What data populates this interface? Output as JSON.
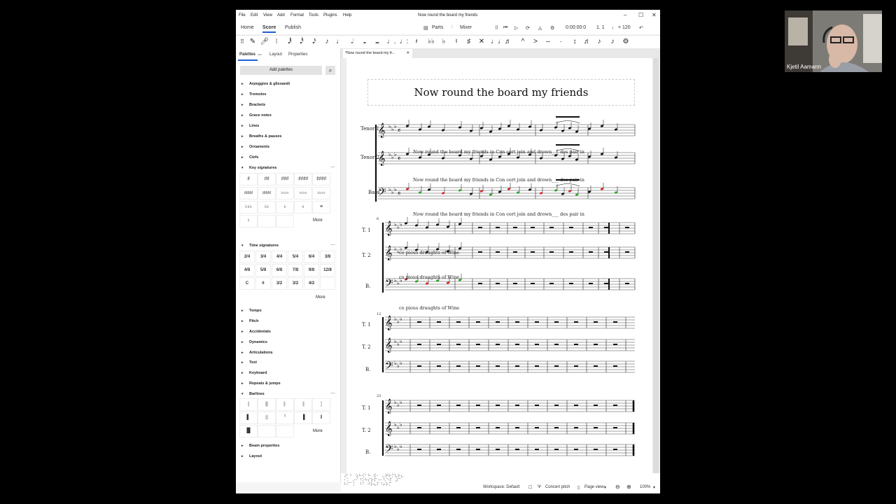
{
  "app": {
    "menu": [
      "File",
      "Edit",
      "View",
      "Add",
      "Format",
      "Tools",
      "Plugins",
      "Help"
    ],
    "window_title": "Now round the board my friends",
    "tabs": [
      "Home",
      "Score",
      "Publish"
    ],
    "toolbar": {
      "parts": "Parts",
      "mixer": "Mixer",
      "time": "0:00:00:0",
      "position": "1. 1",
      "tempo": "♩ = 120"
    }
  },
  "panel": {
    "tabs": [
      "Palettes",
      "Layout",
      "Properties"
    ],
    "add_palettes": "Add palettes",
    "palettes_top": [
      "Arpeggios & glissandi",
      "Tremolos",
      "Brackets",
      "Grace notes",
      "Lines",
      "Breaths & pauses",
      "Ornaments",
      "Clefs"
    ],
    "key_signatures": "Key signatures",
    "time_signatures": "Time signatures",
    "time_sig_cells": [
      "2/4",
      "3/4",
      "4/4",
      "5/4",
      "6/4",
      "3/8",
      "4/8",
      "5/8",
      "6/8",
      "7/8",
      "9/8",
      "12/8",
      "C",
      "¢",
      "3/2",
      "3/2",
      "4/2",
      ""
    ],
    "palettes_mid": [
      "Tempo",
      "Pitch",
      "Accidentals",
      "Dynamics",
      "Articulations",
      "Text",
      "Keyboard",
      "Repeats & jumps"
    ],
    "barlines": "Barlines",
    "palettes_bottom": [
      "Beam properties",
      "Layout"
    ],
    "more": "More"
  },
  "doc_tab": "*Now round the board my fr...",
  "score": {
    "title": "Now round the board my friends",
    "system1_labels": [
      "Tenor 1",
      "Tenor 2",
      "Bass"
    ],
    "short_labels": [
      "T. 1",
      "T. 2",
      "B."
    ],
    "lyrics1": "Now round the board     my friends in Con cert join     and   drown___  des pair   in",
    "lyrics2": "co pious draughts of Wine",
    "measure_numbers": [
      "6",
      "12",
      "23"
    ]
  },
  "status": {
    "workspace": "Workspace: Default",
    "concert_pitch": "Concert pitch",
    "page_view": "Page view",
    "zoom": "100%"
  },
  "braille": [
    "⠼⠁⠃ ⠵⠓⠪⠁⠓ ⠯⠂ ⠤⠟⠗⠍⠧⠗⠦",
    "⠂⠅ ⠔⠊⠘⠕⠓⠎⠗⠏⠐⠂⠣⠑⠏ ⠼⠉",
    "⠓⠊⠁⠅ ⠘⠊ ⠚⠗⠦⠏⠘⠖⠗⠍"
  ],
  "webcam": {
    "name": "Kjetil Aamann"
  }
}
